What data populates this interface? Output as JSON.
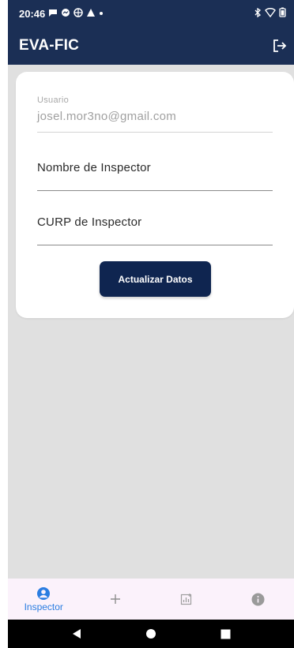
{
  "status_bar": {
    "time": "20:46",
    "left_icons": [
      "chat-icon",
      "messenger-icon",
      "vpn-icon",
      "warning-icon",
      "dot-icon"
    ],
    "right_icons": [
      "bluetooth-icon",
      "wifi-icon",
      "battery-icon"
    ]
  },
  "app_bar": {
    "title": "EVA-FIC",
    "action_icon": "logout-icon"
  },
  "form": {
    "usuario_label": "Usuario",
    "usuario_value": "josel.mor3no@gmail.com",
    "nombre_placeholder": "Nombre de Inspector",
    "curp_placeholder": "CURP de Inspector",
    "submit_label": "Actualizar Datos"
  },
  "bottom_nav": {
    "items": [
      {
        "label": "Inspector",
        "icon": "account-circle-icon",
        "active": true
      },
      {
        "label": "",
        "icon": "add-icon",
        "active": false
      },
      {
        "label": "",
        "icon": "analytics-icon",
        "active": false
      },
      {
        "label": "",
        "icon": "info-icon",
        "active": false
      }
    ]
  },
  "colors": {
    "app_bar": "#1b2f55",
    "button": "#0f2550",
    "active_nav": "#2a7de1",
    "background": "#e0e0e0",
    "bottom_nav": "#fbf2fb"
  }
}
